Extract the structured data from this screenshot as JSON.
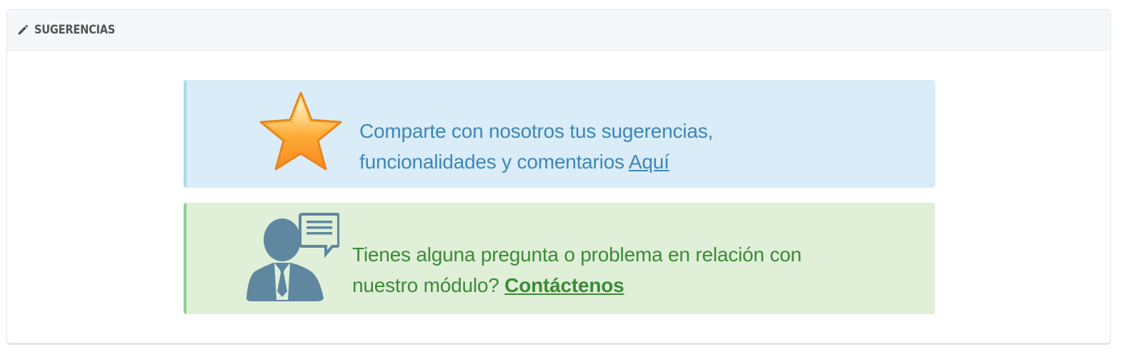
{
  "panel": {
    "title": "SUGERENCIAS",
    "icon": "pencil-icon"
  },
  "suggestions_alert": {
    "icon": "star-icon",
    "line1": "Comparte con nosotros tus sugerencias,",
    "line2": "funcionalidades y comentarios ",
    "link_label": "Aquí",
    "colors": {
      "background": "#d9ecf7",
      "text": "#3d86b8",
      "accent": "#aad8ea"
    }
  },
  "support_alert": {
    "icon": "support-agent-icon",
    "line1": "Tienes alguna pregunta o problema en relación con",
    "line2": "nuestro módulo? ",
    "link_label": "Contáctenos",
    "colors": {
      "background": "#dfefd8",
      "text": "#3d8a36",
      "accent": "#8fcf8f"
    }
  }
}
